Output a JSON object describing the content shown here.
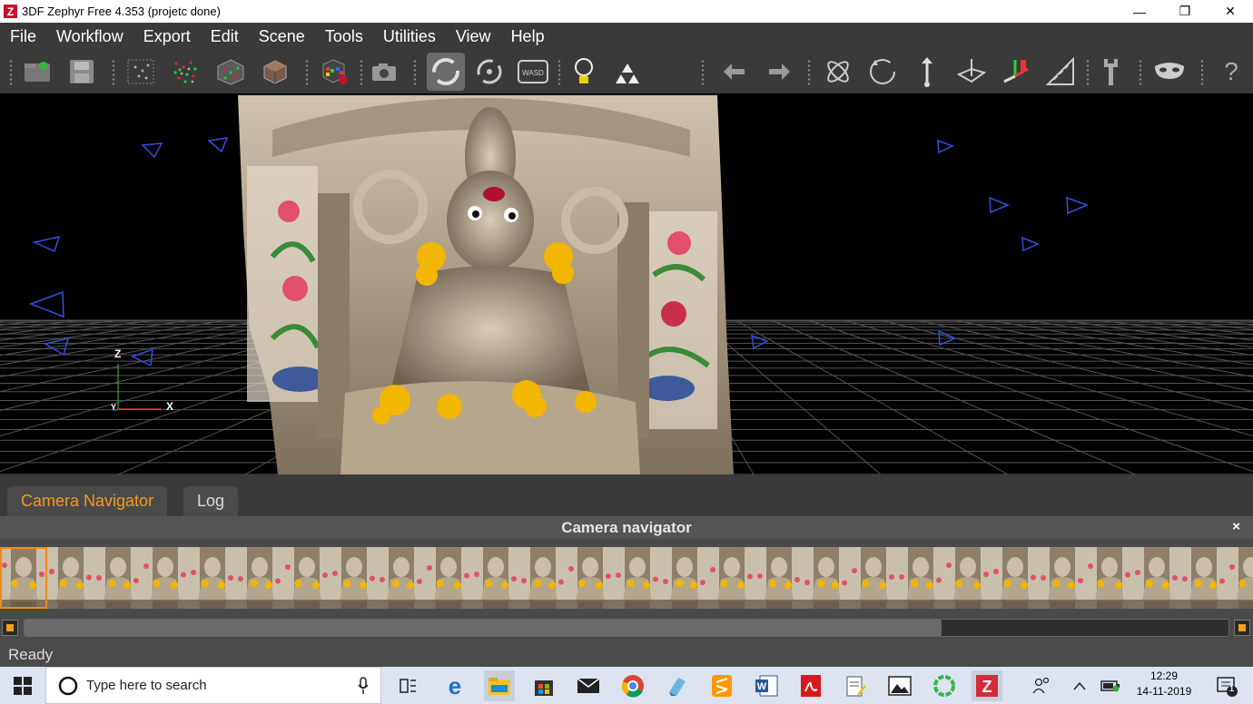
{
  "window": {
    "title": "3DF Zephyr Free 4.353 (projetc done)",
    "logo_letter": "Z",
    "minimize_glyph": "—",
    "restore_glyph": "❐",
    "close_glyph": "✕"
  },
  "menu": [
    "File",
    "Workflow",
    "Export",
    "Edit",
    "Scene",
    "Tools",
    "Utilities",
    "View",
    "Help"
  ],
  "toolbar": {
    "wasd_label": "WASD",
    "help_glyph": "?",
    "icons": [
      "new-project-icon",
      "save-icon",
      "sparse-cloud-icon",
      "dense-cloud-icon",
      "mesh-icon",
      "textured-mesh-icon",
      "rubik-cube-icon",
      "camera-icon",
      "orbit-icon",
      "rotate-icon",
      "wasd-icon",
      "light-bulb-icon",
      "points-icon",
      "undo-icon",
      "redo-icon",
      "atom-icon",
      "reset-icon",
      "vertical-icon",
      "bounding-box-icon",
      "gizmo-icon",
      "ruler-icon",
      "wrench-icon",
      "mask-icon",
      "help-icon"
    ]
  },
  "viewport": {
    "axis": {
      "z": "Z",
      "y": "Y",
      "x": "X"
    }
  },
  "panel": {
    "tabs": [
      {
        "label": "Camera Navigator",
        "active": true
      },
      {
        "label": "Log",
        "active": false
      }
    ],
    "title": "Camera navigator",
    "close_glyph": "×",
    "thumbnail_count": 27,
    "selected_index": 0
  },
  "status": {
    "text": "Ready"
  },
  "taskbar": {
    "search_placeholder": "Type here to search",
    "time": "12:29",
    "date": "14-11-2019",
    "notification_count": "1",
    "apps": [
      "task-view-icon",
      "edge-icon",
      "file-explorer-icon",
      "store-icon",
      "mail-icon",
      "chrome-icon",
      "paint-icon",
      "sublime-icon",
      "word-icon",
      "acrobat-icon",
      "notepad-icon",
      "photos-icon",
      "circle-app-icon",
      "zephyr-icon"
    ]
  },
  "colors": {
    "accent": "#f29a1a",
    "menu_bg": "#3a3a3a",
    "camera_frustum": "#3050e0"
  }
}
